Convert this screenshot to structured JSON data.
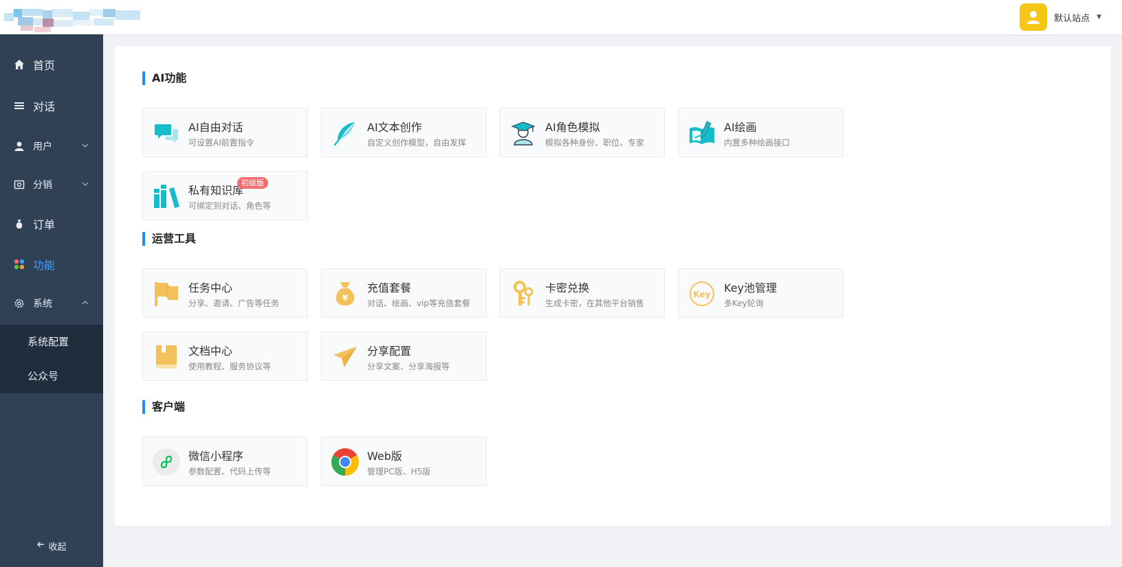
{
  "header": {
    "site_name": "默认站点",
    "colors": {
      "avatar_bg": "#f5c518"
    }
  },
  "sidebar": {
    "items": [
      {
        "label": "首页",
        "icon": "home-icon"
      },
      {
        "label": "对话",
        "icon": "list-icon"
      },
      {
        "label": "用户",
        "icon": "user-icon",
        "expandable": true
      },
      {
        "label": "分销",
        "icon": "distribution-icon",
        "expandable": true
      },
      {
        "label": "订单",
        "icon": "money-bag-icon"
      },
      {
        "label": "功能",
        "icon": "apps-icon",
        "active": true
      },
      {
        "label": "系统",
        "icon": "gear-icon",
        "expandable": true,
        "expanded": true
      }
    ],
    "subitems": [
      {
        "label": "系统配置"
      },
      {
        "label": "公众号"
      }
    ],
    "collapse_label": "收起",
    "colors": {
      "bg": "#304156",
      "sub_bg": "#1f2d3d",
      "active": "#409eff"
    }
  },
  "sections": [
    {
      "title": "AI功能",
      "cards": [
        {
          "title": "AI自由对话",
          "desc": "可设置AI前置指令",
          "icon": "chat-bubbles-icon"
        },
        {
          "title": "AI文本创作",
          "desc": "自定义创作模型，自由发挥",
          "icon": "feather-pen-icon"
        },
        {
          "title": "AI角色模拟",
          "desc": "模拟各种身份、职位、专家",
          "icon": "graduate-icon"
        },
        {
          "title": "AI绘画",
          "desc": "内置多种绘画接口",
          "icon": "painting-icon"
        },
        {
          "title": "私有知识库",
          "desc": "可绑定到对话、角色等",
          "icon": "books-icon",
          "badge": "初级版"
        }
      ]
    },
    {
      "title": "运营工具",
      "cards": [
        {
          "title": "任务中心",
          "desc": "分享、邀请、广告等任务",
          "icon": "flag-icon"
        },
        {
          "title": "充值套餐",
          "desc": "对话、绘画、vip等充值套餐",
          "icon": "money-bag-icon"
        },
        {
          "title": "卡密兑换",
          "desc": "生成卡密，在其他平台销售",
          "icon": "key-icon"
        },
        {
          "title": "Key池管理",
          "desc": "多Key轮询",
          "icon": "key-circle-icon",
          "icon_text": "Key"
        },
        {
          "title": "文档中心",
          "desc": "使用教程、服务协议等",
          "icon": "book-icon"
        },
        {
          "title": "分享配置",
          "desc": "分享文案、分享海报等",
          "icon": "paper-plane-icon"
        }
      ]
    },
    {
      "title": "客户端",
      "cards": [
        {
          "title": "微信小程序",
          "desc": "参数配置、代码上传等",
          "icon": "mini-program-icon"
        },
        {
          "title": "Web版",
          "desc": "管理PC版、H5版",
          "icon": "chrome-icon"
        }
      ]
    }
  ],
  "colors": {
    "teal": "#17bcc9",
    "gold": "#f3c15a",
    "accent": "#1890ff",
    "badge": "#f56c6c"
  }
}
